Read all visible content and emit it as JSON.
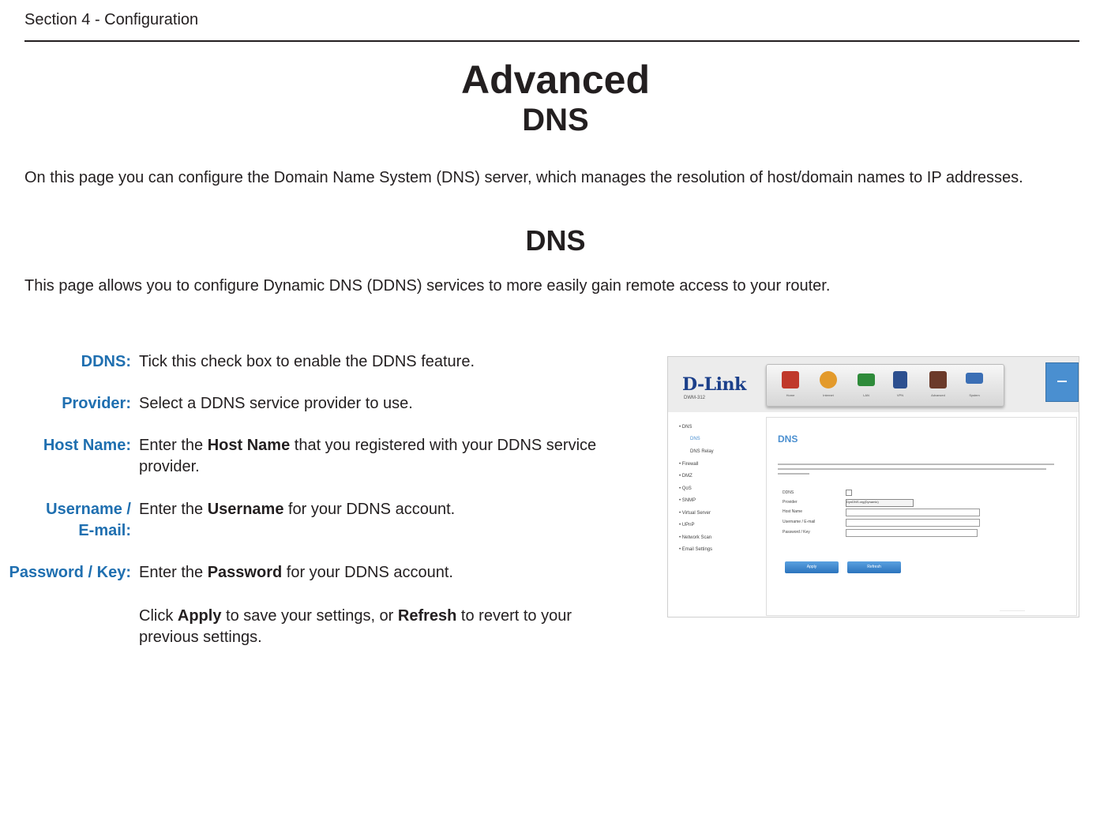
{
  "section_header": "Section 4 - Configuration",
  "title": "Advanced",
  "subtitle": "DNS",
  "intro": "On this page you can configure the Domain Name System (DNS) server, which manages the resolution of host/domain names to IP addresses.",
  "dns_heading": "DNS",
  "dns_description": "This page allows you to configure Dynamic DNS (DDNS) services to more easily gain remote access to your router.",
  "definitions": [
    {
      "term": "DDNS:",
      "pre": "Tick this check box to enable the DDNS feature.",
      "bold": "",
      "post": ""
    },
    {
      "term": "Provider:",
      "pre": "Select a DDNS service provider to use.",
      "bold": "",
      "post": ""
    },
    {
      "term": "Host Name:",
      "pre": "Enter the ",
      "bold": "Host Name",
      "post": " that you registered with your DDNS service provider."
    },
    {
      "term_line1": "Username /",
      "term_line2": "E-mail:",
      "pre": "Enter the ",
      "bold": "Username",
      "post": " for your DDNS account."
    },
    {
      "term": "Password / Key:",
      "pre": "Enter the ",
      "bold": "Password",
      "post": " for your DDNS account."
    }
  ],
  "closing": {
    "pre": "Click ",
    "b1": "Apply",
    "mid": " to save your settings, or ",
    "b2": "Refresh",
    "post": " to revert to your previous settings."
  },
  "screenshot": {
    "logo": "D-Link",
    "model": "DWM-312",
    "nav": [
      {
        "label": "Home",
        "icon": "home-icon",
        "color": "#c0392b"
      },
      {
        "label": "Internet",
        "icon": "globe-icon",
        "color": "#e39a2b"
      },
      {
        "label": "LAN",
        "icon": "lan-icon",
        "color": "#2e8b3a"
      },
      {
        "label": "VPN",
        "icon": "lock-icon",
        "color": "#2c4f8f"
      },
      {
        "label": "Advanced",
        "icon": "advanced-icon",
        "color": "#6b3a2a"
      },
      {
        "label": "System",
        "icon": "system-icon",
        "color": "#3b6fb5"
      }
    ],
    "side_menu": [
      {
        "label": "• DNS",
        "sub": false,
        "active": false
      },
      {
        "label": "DNS",
        "sub": true,
        "active": true
      },
      {
        "label": "DNS Relay",
        "sub": true,
        "active": false
      },
      {
        "label": "• Firewall",
        "sub": false,
        "active": false
      },
      {
        "label": "• DMZ",
        "sub": false,
        "active": false
      },
      {
        "label": "• QoS",
        "sub": false,
        "active": false
      },
      {
        "label": "• SNMP",
        "sub": false,
        "active": false
      },
      {
        "label": "• Virtual Server",
        "sub": false,
        "active": false
      },
      {
        "label": "• UPnP",
        "sub": false,
        "active": false
      },
      {
        "label": "• Network Scan",
        "sub": false,
        "active": false
      },
      {
        "label": "• Email Settings",
        "sub": false,
        "active": false
      }
    ],
    "content_title": "DNS",
    "form": {
      "ddns_label": "DDNS",
      "provider_label": "Provider",
      "provider_value": "DynDNS.org(Dynamic)",
      "host_label": "Host Name",
      "user_label": "Username / E-mail",
      "pass_label": "Password / Key"
    },
    "apply_label": "Apply",
    "refresh_label": "Refresh"
  }
}
